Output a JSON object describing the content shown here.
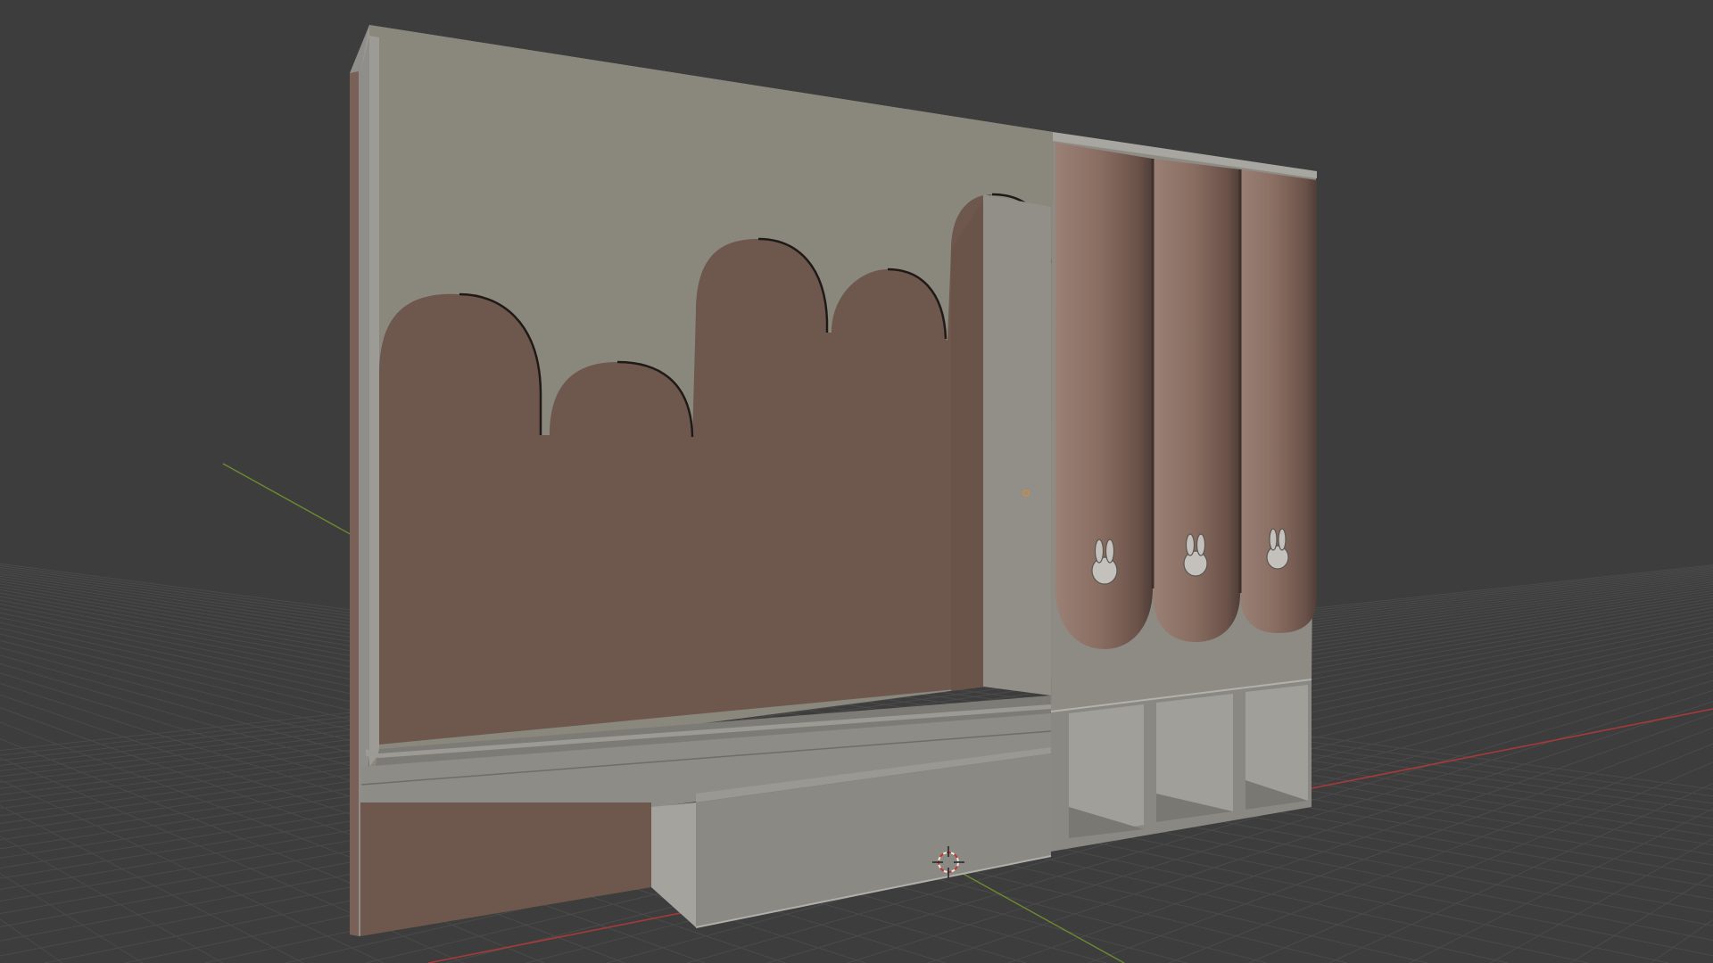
{
  "app": "3D viewport",
  "scene": {
    "background_color": "#3d3d3d",
    "grid_color": "#4a4a4a",
    "axis_x_color": "#b23a3a",
    "axis_y_color": "#6f8f2f",
    "panel_gray": "#8a877d",
    "panel_brown": "#6e584d",
    "tube_color": "#8e7468",
    "bunny_color": "#c4c1bc"
  },
  "objects": {
    "wall_panel": "wall-panel",
    "left_upright": "left-upright",
    "bench": "bench-seat",
    "drawer_box": "drawer-box",
    "shoe_shelf": "shoe-shelf",
    "tubes": [
      "tube-1",
      "tube-2",
      "tube-3"
    ],
    "bunny_icons": [
      "bunny-icon-1",
      "bunny-icon-2",
      "bunny-icon-3"
    ]
  },
  "cursor": {
    "name": "3d-cursor-icon"
  }
}
